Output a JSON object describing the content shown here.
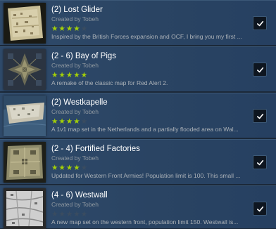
{
  "items": [
    {
      "title": "(2) Lost Glider",
      "author": "Created by Tobeh",
      "rating": 4,
      "description": "Inspired by the British Forces expansion and OCF, I bring you my first ...",
      "subscribed": true
    },
    {
      "title": "(2 - 6) Bay of Pigs",
      "author": "Created by Tobeh",
      "rating": 5,
      "description": "A remake of the classic map for Red Alert 2.",
      "subscribed": true
    },
    {
      "title": "(2) Westkapelle",
      "author": "Created by Tobeh",
      "rating": 4,
      "description": "A 1v1 map set in the Netherlands and a partially flooded area on Wal...",
      "subscribed": true
    },
    {
      "title": "(2 - 4) Fortified Factories",
      "author": "Created by Tobeh",
      "rating": 4,
      "description": "Updated for Western Front Armies! Population limit is 100. This small ...",
      "subscribed": true
    },
    {
      "title": "(4 - 6) Westwall",
      "author": "Created by Tobeh",
      "rating": 0,
      "description": "A new map set on the western front, population limit 150. Westwall is...",
      "subscribed": true
    }
  ],
  "colors": {
    "background": "#1b2838",
    "star_on": "#a4d007",
    "star_off": "#3a4c60",
    "title": "#ffffff",
    "author": "#8f98a0",
    "description": "#acb2b8"
  },
  "icons": {
    "checkbox": "checkmark-icon"
  }
}
